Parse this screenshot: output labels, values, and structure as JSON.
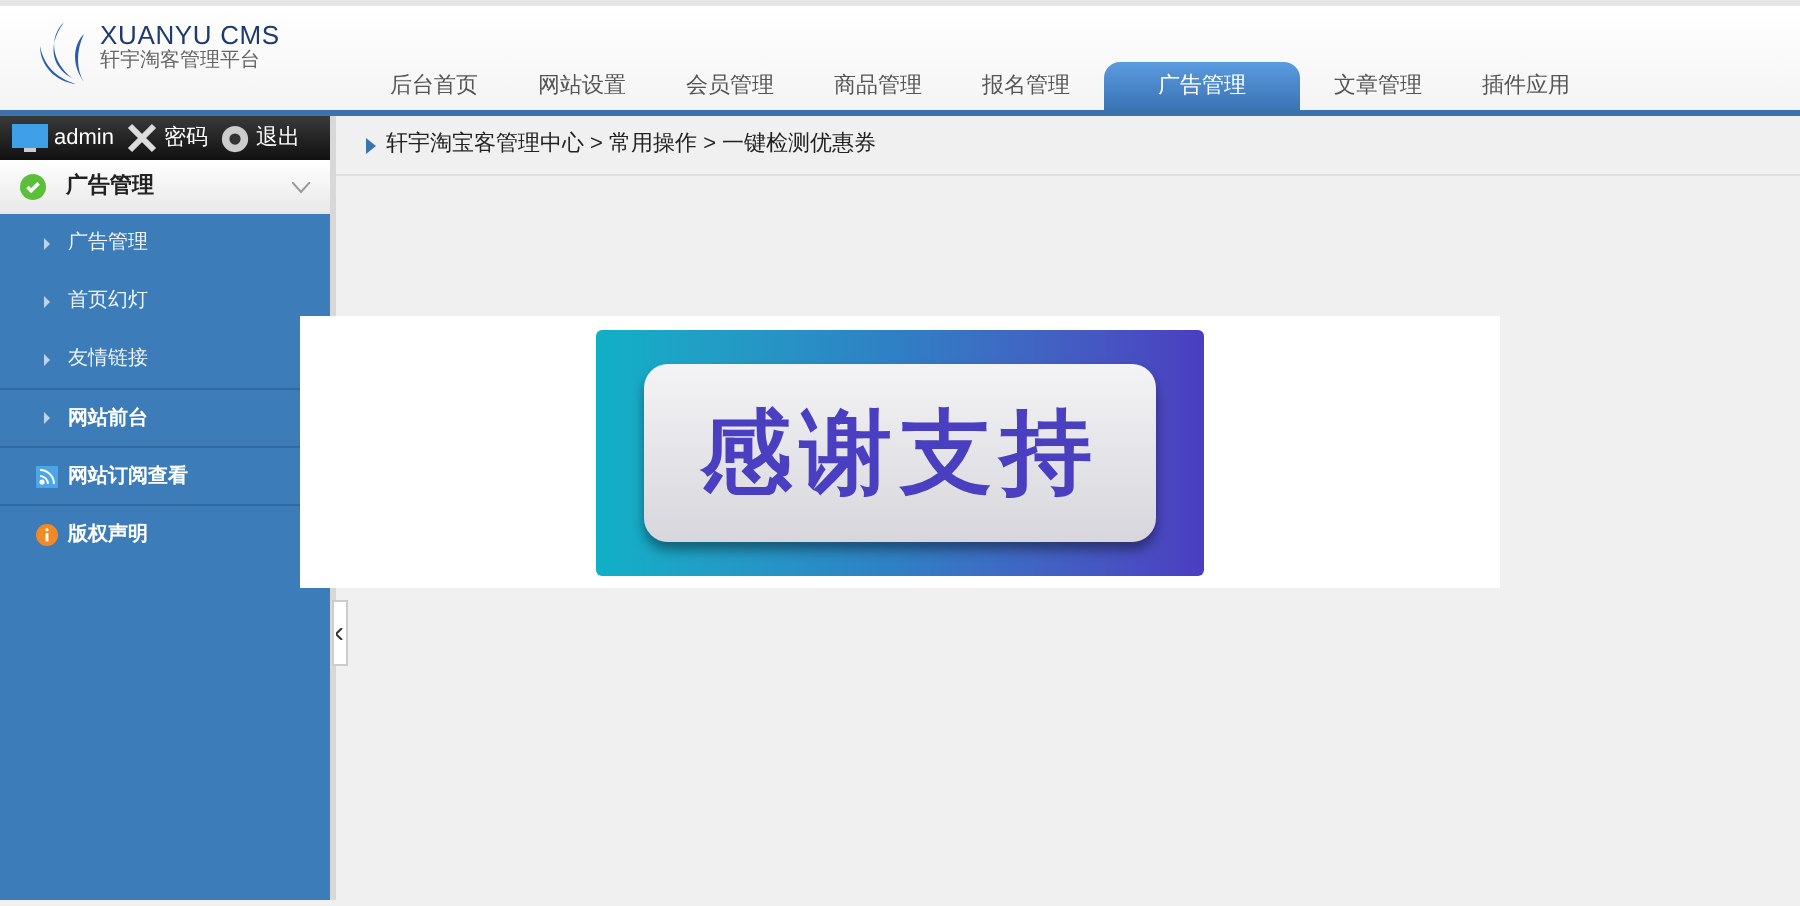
{
  "logo": {
    "title": "XUANYU CMS",
    "subtitle": "轩宇淘客管理平台"
  },
  "tabs": [
    {
      "label": "后台首页",
      "selected": false
    },
    {
      "label": "网站设置",
      "selected": false
    },
    {
      "label": "会员管理",
      "selected": false
    },
    {
      "label": "商品管理",
      "selected": false
    },
    {
      "label": "报名管理",
      "selected": false
    },
    {
      "label": "广告管理",
      "selected": true
    },
    {
      "label": "文章管理",
      "selected": false
    },
    {
      "label": "插件应用",
      "selected": false
    }
  ],
  "user_bar": [
    {
      "kind": "user",
      "label": "admin"
    },
    {
      "kind": "password",
      "label": "密码"
    },
    {
      "kind": "logout",
      "label": "退出"
    }
  ],
  "sidebar": {
    "group": {
      "label": "广告管理",
      "expanded": true,
      "children": [
        {
          "label": "广告管理"
        },
        {
          "label": "首页幻灯"
        },
        {
          "label": "友情链接"
        }
      ]
    },
    "items": [
      {
        "kind": "link",
        "label": "网站前台"
      },
      {
        "kind": "rss",
        "label": "网站订阅查看"
      },
      {
        "kind": "info",
        "label": "版权声明"
      }
    ]
  },
  "breadcrumb": "轩宇淘宝客管理中心 > 常用操作 > 一键检测优惠券",
  "dialog": {
    "banner_text": "感谢支持"
  }
}
